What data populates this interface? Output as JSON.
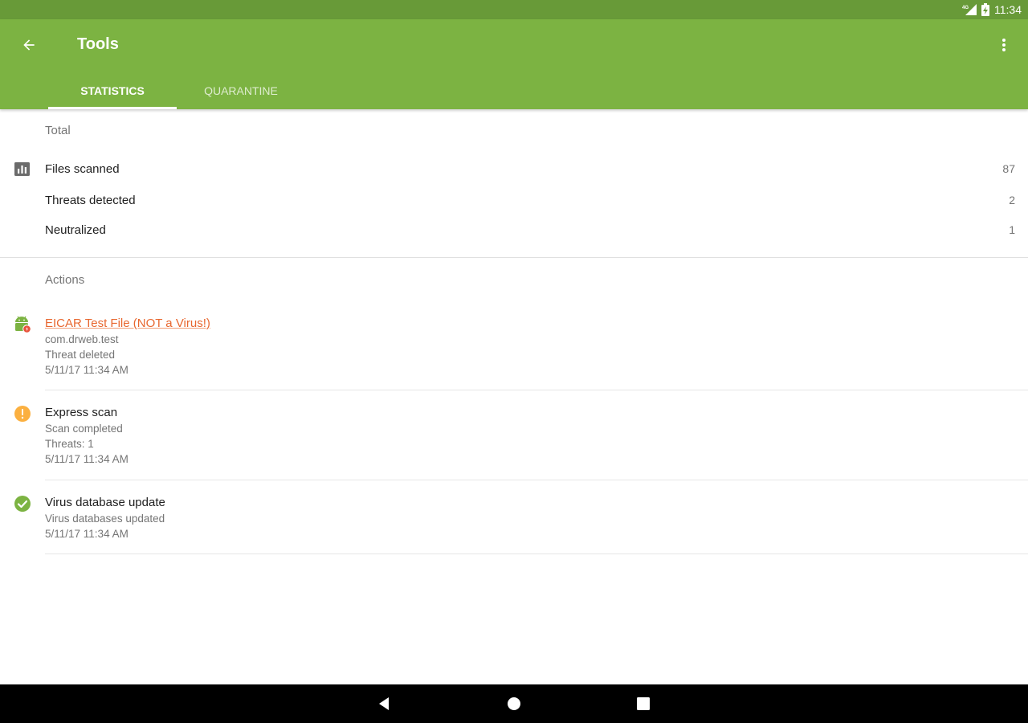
{
  "status_bar": {
    "network": "4G",
    "battery_icon": "battery-charging-icon",
    "time": "11:34"
  },
  "app_bar": {
    "title": "Tools",
    "back_icon": "arrow-left-icon",
    "menu_icon": "more-vert-icon",
    "tabs": [
      {
        "label": "STATISTICS",
        "active": true
      },
      {
        "label": "QUARANTINE",
        "active": false
      }
    ]
  },
  "total": {
    "header": "Total",
    "icon": "bar-chart-icon",
    "rows": [
      {
        "label": "Files scanned",
        "value": "87"
      },
      {
        "label": "Threats detected",
        "value": "2"
      },
      {
        "label": "Neutralized",
        "value": "1"
      }
    ]
  },
  "actions": {
    "header": "Actions",
    "items": [
      {
        "icon": "android-threat-icon",
        "title": "EICAR Test File (NOT a Virus!)",
        "lines": [
          "com.drweb.test",
          "Threat deleted",
          "5/11/17 11:34 AM"
        ]
      },
      {
        "icon": "warning-circle-icon",
        "title": "Express scan",
        "lines": [
          "Scan completed",
          "Threats: 1",
          "5/11/17 11:34 AM"
        ]
      },
      {
        "icon": "check-circle-icon",
        "title": "Virus database update",
        "lines": [
          "Virus databases updated",
          "5/11/17 11:34 AM"
        ]
      }
    ]
  },
  "colors": {
    "primary": "#7cb342",
    "primary_dark": "#689a38",
    "link": "#e8672f",
    "warning": "#fbb040",
    "success": "#7cb342"
  }
}
